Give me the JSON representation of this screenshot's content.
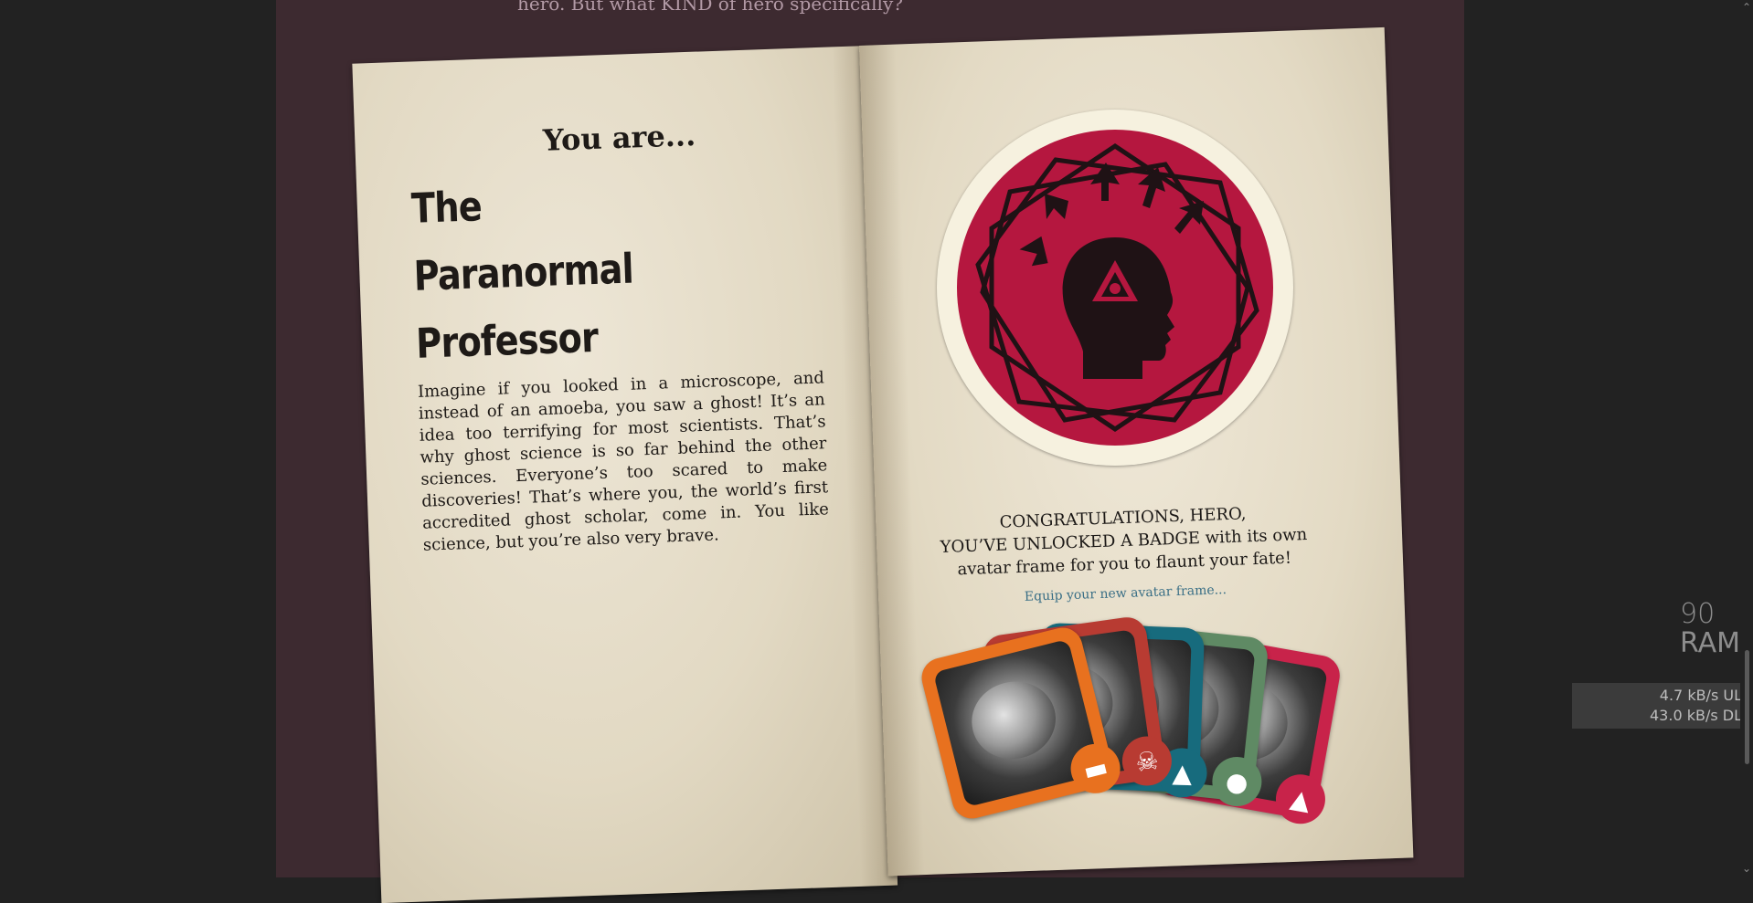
{
  "intro_text": "hero. But what KIND of hero specifically?",
  "left_page": {
    "you_are": "You are...",
    "hero_name": "The Paranormal Professor",
    "description": "Imagine if you looked in a microscope, and instead of an amoeba, you saw a ghost! It’s an idea too terrifying for most scientists. That’s why ghost science is so far behind the other sciences. Everyone’s too scared to make discoveries! That’s where you, the world’s first accredited ghost scholar, come in. You like science, but you’re also very brave."
  },
  "badge": {
    "icon": "head-with-triangle-eye-and-arrows-icon",
    "fill_color": "#b5173f",
    "ring_color": "#f6f1df"
  },
  "congrats": {
    "line1": "CONGRATULATIONS, HERO,",
    "line2": "YOU’VE UNLOCKED A BADGE with its own avatar frame for you to flaunt your fate!",
    "equip_link": "Equip your new avatar frame..."
  },
  "avatar_frames": [
    {
      "color": "#c8234a",
      "emblem": "triangle-eye-head-icon"
    },
    {
      "color": "#5f8a64",
      "emblem": "gorilla-icon"
    },
    {
      "color": "#176b7d",
      "emblem": "ghost-icon"
    },
    {
      "color": "#b83b32",
      "emblem": "skull-icon"
    },
    {
      "color": "#e8711f",
      "emblem": "mask-icon"
    }
  ],
  "system_overlay": {
    "ram_value": "90",
    "ram_label": "RAM",
    "upload": "4.7 kB/s  UL",
    "download": "43.0 kB/s  DL"
  }
}
